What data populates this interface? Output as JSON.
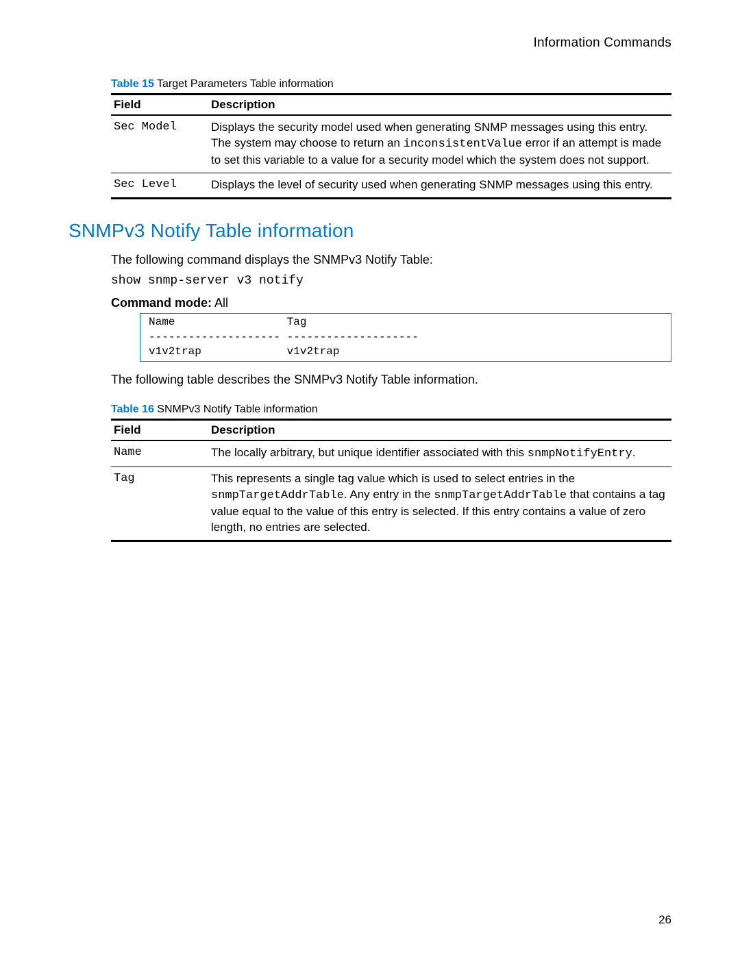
{
  "header": {
    "category": "Information Commands"
  },
  "table15": {
    "caption_label": "Table 15",
    "caption_text": "Target Parameters Table information",
    "header_field": "Field",
    "header_desc": "Description",
    "rows": [
      {
        "field": "Sec Model",
        "desc_pre": "Displays the security model used when generating SNMP messages using this entry. The system may choose to return an ",
        "desc_code": "inconsistentValue",
        "desc_post": " error if an attempt is made to set this variable to a value for a security model which the system does not support."
      },
      {
        "field": "Sec Level",
        "desc_pre": "Displays the level of security used when generating SNMP messages using this entry.",
        "desc_code": "",
        "desc_post": ""
      }
    ]
  },
  "section": {
    "heading": "SNMPv3 Notify Table information",
    "intro": "The following command displays the SNMPv3 Notify Table:",
    "command": "show snmp-server v3 notify",
    "mode_label": "Command mode:",
    "mode_value": " All",
    "output": "Name                 Tag\n-------------------- --------------------\nv1v2trap             v1v2trap",
    "table_intro": "The following table describes the SNMPv3 Notify Table information."
  },
  "table16": {
    "caption_label": "Table 16",
    "caption_text": "SNMPv3 Notify Table information",
    "header_field": "Field",
    "header_desc": "Description",
    "rows": [
      {
        "field": "Name",
        "desc_pre": "The locally arbitrary, but unique identifier associated with this ",
        "desc_code": "snmpNotifyEntry",
        "desc_post": "."
      },
      {
        "field": "Tag",
        "desc_pre": "This represents a single tag value which is used to select entries in the ",
        "desc_code": "snmpTargetAddrTable",
        "desc_mid": ". Any entry in the ",
        "desc_code2": "snmpTargetAddrTable",
        "desc_post": " that contains a tag value equal to the value of this entry is selected. If this entry contains a value of zero length, no entries are selected."
      }
    ]
  },
  "page_number": "26"
}
